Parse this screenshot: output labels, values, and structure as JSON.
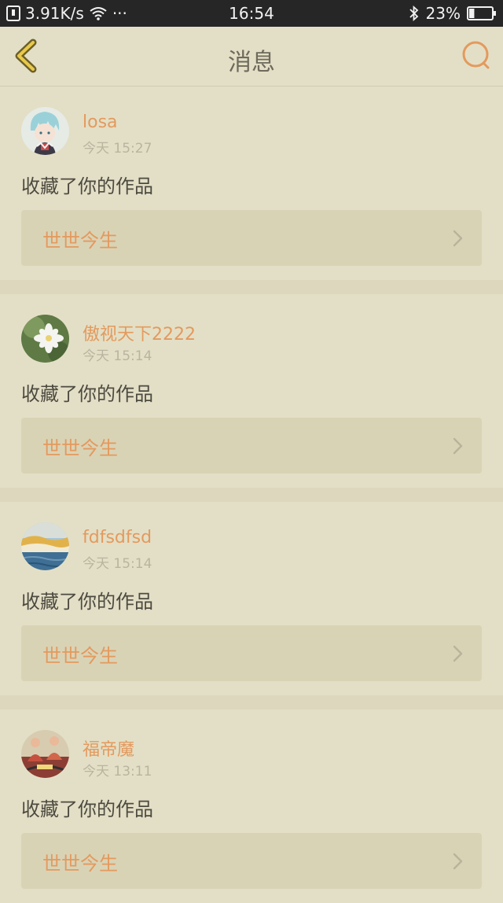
{
  "status_bar": {
    "speed": "3.91K/s",
    "dots": "···",
    "time": "16:54",
    "battery": "23%",
    "battery_level": 0.23
  },
  "navbar": {
    "title": "消息"
  },
  "colors": {
    "accent": "#e39a5e",
    "background": "#e3dfc6",
    "card_box": "#d9d3b6",
    "status_bar": "#262626"
  },
  "messages": [
    {
      "username": "losa",
      "time": "今天 15:27",
      "action": "收藏了你的作品",
      "work_title": "世世今生",
      "avatar_icon": "anime-avatar-icon"
    },
    {
      "username": "傲视天下2222",
      "time": "今天 15:14",
      "action": "收藏了你的作品",
      "work_title": "世世今生",
      "avatar_icon": "flower-avatar-icon"
    },
    {
      "username": "fdfsdfsd",
      "time": "今天 15:14",
      "action": "收藏了你的作品",
      "work_title": "世世今生",
      "avatar_icon": "landscape-avatar-icon"
    },
    {
      "username": "福帝魔",
      "time": "今天 13:11",
      "action": "收藏了你的作品",
      "work_title": "世世今生",
      "avatar_icon": "people-avatar-icon"
    }
  ]
}
